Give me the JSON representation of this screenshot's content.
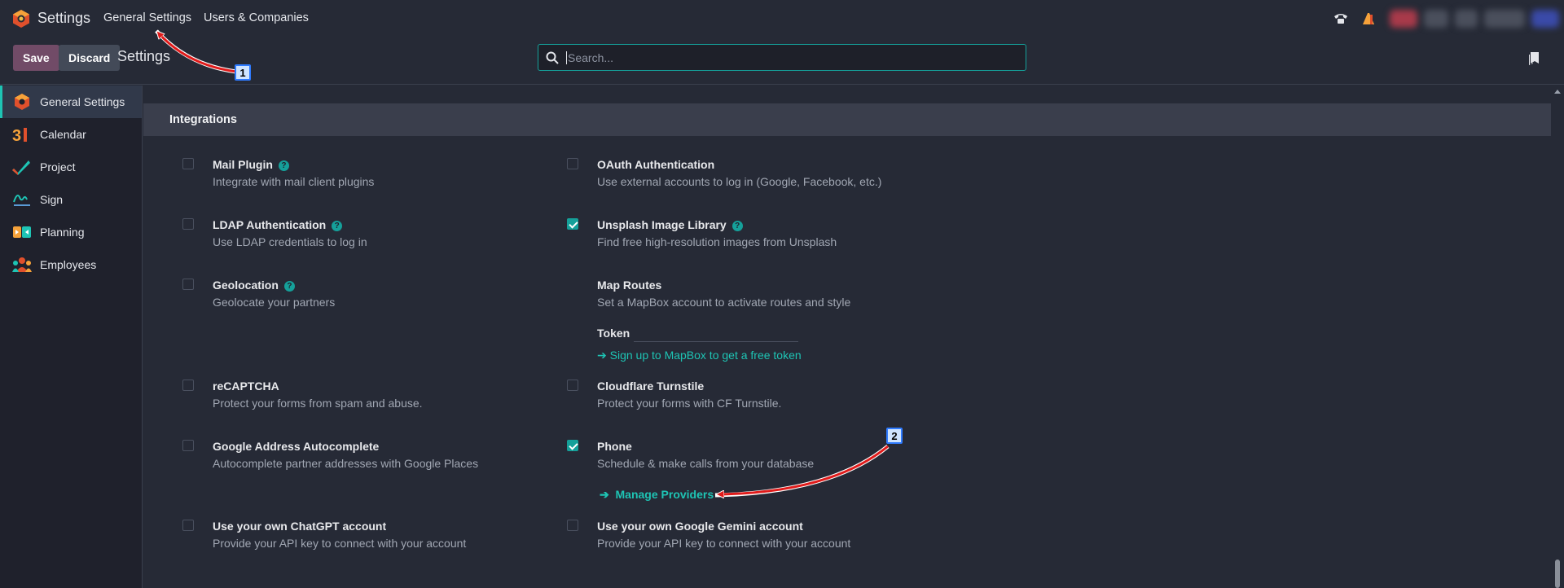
{
  "navbar": {
    "app_name": "Settings",
    "menu": [
      "General Settings",
      "Users & Companies"
    ]
  },
  "control_panel": {
    "save_label": "Save",
    "discard_label": "Discard",
    "title": "Settings",
    "search_placeholder": "Search..."
  },
  "sidebar": {
    "items": [
      {
        "label": "General Settings",
        "icon": "settings-app-icon",
        "active": true
      },
      {
        "label": "Calendar",
        "icon": "calendar-app-icon"
      },
      {
        "label": "Project",
        "icon": "project-app-icon"
      },
      {
        "label": "Sign",
        "icon": "sign-app-icon"
      },
      {
        "label": "Planning",
        "icon": "planning-app-icon"
      },
      {
        "label": "Employees",
        "icon": "employees-app-icon"
      }
    ]
  },
  "section": {
    "title": "Integrations",
    "settings": {
      "mail_plugin": {
        "title": "Mail Plugin",
        "desc": "Integrate with mail client plugins",
        "checked": false
      },
      "oauth": {
        "title": "OAuth Authentication",
        "desc": "Use external accounts to log in (Google, Facebook, etc.)",
        "checked": false
      },
      "ldap": {
        "title": "LDAP Authentication",
        "desc": "Use LDAP credentials to log in",
        "checked": false
      },
      "unsplash": {
        "title": "Unsplash Image Library",
        "desc": "Find free high-resolution images from Unsplash",
        "checked": true
      },
      "geolocation": {
        "title": "Geolocation",
        "desc": "Geolocate your partners",
        "checked": false
      },
      "map_routes": {
        "title": "Map Routes",
        "desc": "Set a MapBox account to activate routes and style",
        "token_label": "Token",
        "link": "Sign up to MapBox to get a free token"
      },
      "recaptcha": {
        "title": "reCAPTCHA",
        "desc": "Protect your forms from spam and abuse.",
        "checked": false
      },
      "turnstile": {
        "title": "Cloudflare Turnstile",
        "desc": "Protect your forms with CF Turnstile.",
        "checked": false
      },
      "google_address": {
        "title": "Google Address Autocomplete",
        "desc": "Autocomplete partner addresses with Google Places",
        "checked": false
      },
      "phone": {
        "title": "Phone",
        "desc": "Schedule & make calls from your database",
        "link": "Manage Providers",
        "checked": true
      },
      "chatgpt": {
        "title": "Use your own ChatGPT account",
        "desc": "Provide your API key to connect with your account",
        "checked": false
      },
      "gemini": {
        "title": "Use your own Google Gemini account",
        "desc": "Provide your API key to connect with your account",
        "checked": false
      }
    }
  },
  "annotations": {
    "badge1": "1",
    "badge2": "2"
  },
  "colors": {
    "accent": "#15a09a",
    "primary_button": "#714b67",
    "annotation_arrow": "#e01b1b"
  }
}
